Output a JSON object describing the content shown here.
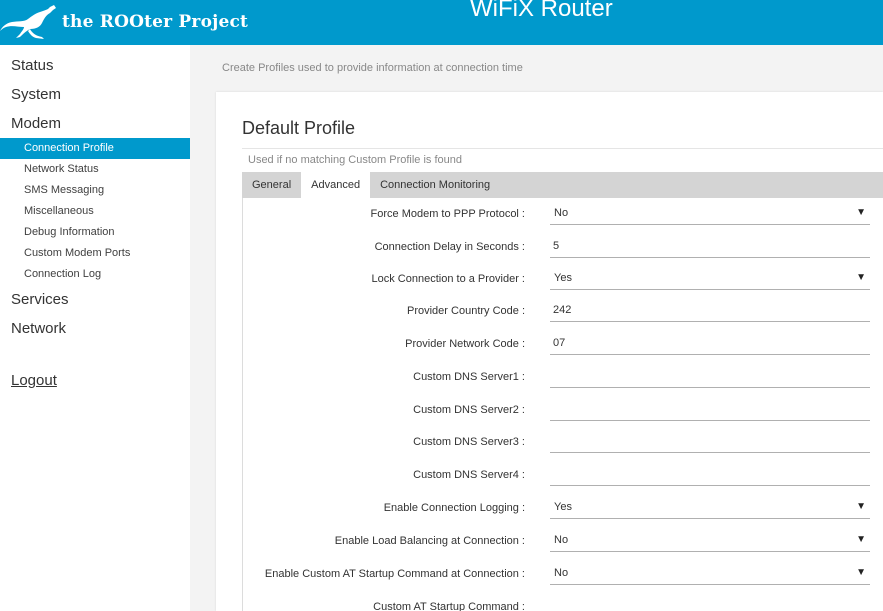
{
  "header": {
    "brand": "the ROOter Project",
    "title": "WiFiX Router"
  },
  "sidebar": {
    "items": [
      {
        "label": "Status"
      },
      {
        "label": "System"
      },
      {
        "label": "Modem"
      }
    ],
    "modem_sub": [
      {
        "label": "Connection Profile"
      },
      {
        "label": "Network Status"
      },
      {
        "label": "SMS Messaging"
      },
      {
        "label": "Miscellaneous"
      },
      {
        "label": "Debug Information"
      },
      {
        "label": "Custom Modem Ports"
      },
      {
        "label": "Connection Log"
      }
    ],
    "items_after": [
      {
        "label": "Services"
      },
      {
        "label": "Network"
      }
    ],
    "logout": "Logout",
    "active": "Connection Profile"
  },
  "main": {
    "description": "Create Profiles used to provide information at connection time",
    "section": {
      "title": "Default Profile",
      "subtitle": "Used if no matching Custom Profile is found"
    },
    "tabs": [
      {
        "label": "General"
      },
      {
        "label": "Advanced"
      },
      {
        "label": "Connection Monitoring"
      }
    ],
    "active_tab": "Advanced",
    "fields": [
      {
        "label": "Force Modem to PPP Protocol :",
        "type": "select",
        "value": "No"
      },
      {
        "label": "Connection Delay in Seconds :",
        "type": "input",
        "value": "5"
      },
      {
        "label": "Lock Connection to a Provider :",
        "type": "select",
        "value": "Yes"
      },
      {
        "label": "Provider Country Code :",
        "type": "input",
        "value": "242"
      },
      {
        "label": "Provider Network Code :",
        "type": "input",
        "value": "07"
      },
      {
        "label": "Custom DNS Server1 :",
        "type": "input",
        "value": ""
      },
      {
        "label": "Custom DNS Server2 :",
        "type": "input",
        "value": ""
      },
      {
        "label": "Custom DNS Server3 :",
        "type": "input",
        "value": ""
      },
      {
        "label": "Custom DNS Server4 :",
        "type": "input",
        "value": ""
      },
      {
        "label": "Enable Connection Logging :",
        "type": "select",
        "value": "Yes"
      },
      {
        "label": "Enable Load Balancing at Connection :",
        "type": "select",
        "value": "No"
      },
      {
        "label": "Enable Custom AT Startup Command at Connection :",
        "type": "select",
        "value": "No"
      },
      {
        "label": "Custom AT Startup Command :",
        "type": "input",
        "value": ""
      }
    ]
  },
  "colors": {
    "accent": "#0099cc",
    "tabbar": "#d4d4d4",
    "background": "#f3f3f3"
  },
  "icons": {
    "logo": "kangaroo-logo-icon",
    "dropdown": "triangle-down-icon"
  }
}
